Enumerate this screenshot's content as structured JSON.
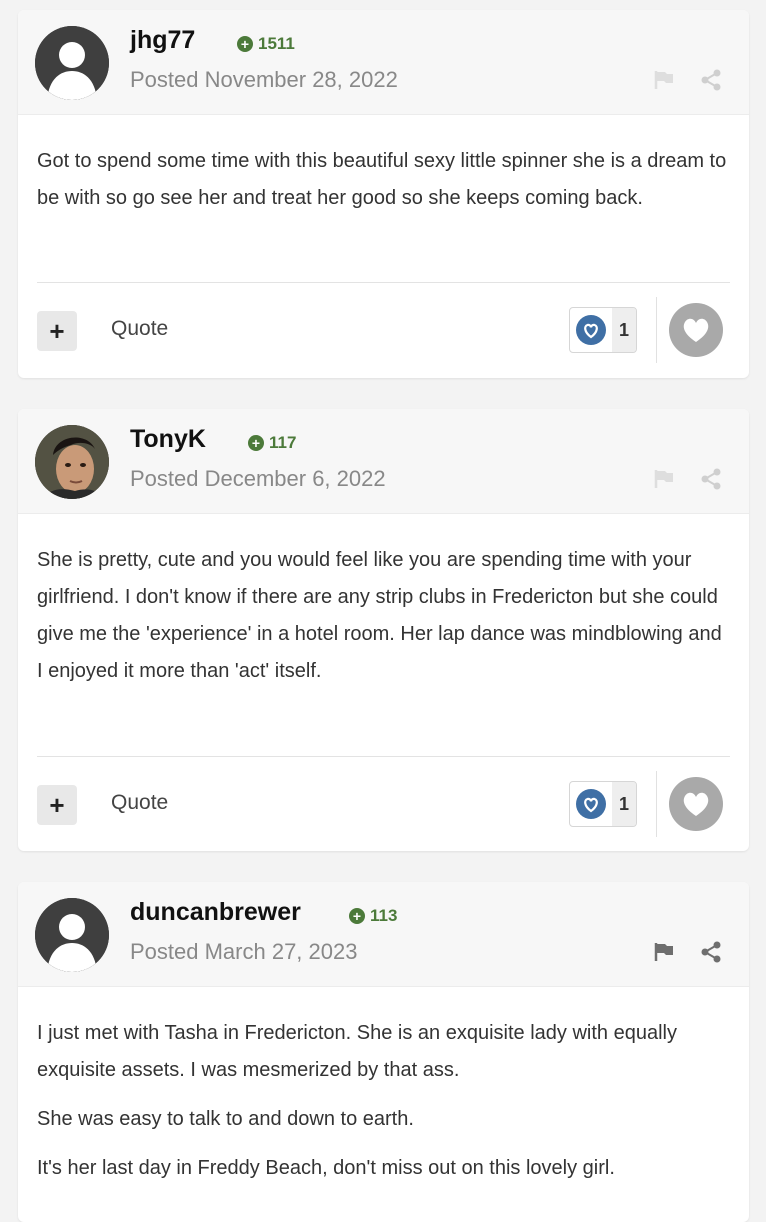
{
  "colors": {
    "reputation_green": "#4c7a3a",
    "reaction_blue": "#3f6fa5",
    "react_button_grey": "#a9a9a9"
  },
  "posts": [
    {
      "username": "jhg77",
      "reputation": "1511",
      "posted": "Posted November 28, 2022",
      "avatar": "default-avatar-icon",
      "paragraphs": [
        "Got to spend some time with this beautiful sexy little spinner she is a dream  to be with so go see her and treat her good so she keeps coming back."
      ],
      "quote_label": "Quote",
      "plus_label": "+",
      "reaction_count": "1"
    },
    {
      "username": "TonyK",
      "reputation": "117",
      "posted": "Posted December 6, 2022",
      "avatar": "user-photo-avatar",
      "paragraphs": [
        "She is pretty, cute and you would feel like you are spending time with your girlfriend. I don't know if there are any strip clubs in Fredericton but she could give me the 'experience' in a hotel room. Her lap dance was mindblowing and I enjoyed it more than 'act' itself."
      ],
      "quote_label": "Quote",
      "plus_label": "+",
      "reaction_count": "1"
    },
    {
      "username": "duncanbrewer",
      "reputation": "113",
      "posted": "Posted March 27, 2023",
      "avatar": "default-avatar-icon",
      "paragraphs": [
        "I just met with Tasha in Fredericton. She is an exquisite lady with equally exquisite assets. I was mesmerized by that ass.",
        "She was easy to talk to and down to earth.",
        "It's her last day in Freddy Beach, don't miss out on this lovely girl."
      ]
    }
  ]
}
